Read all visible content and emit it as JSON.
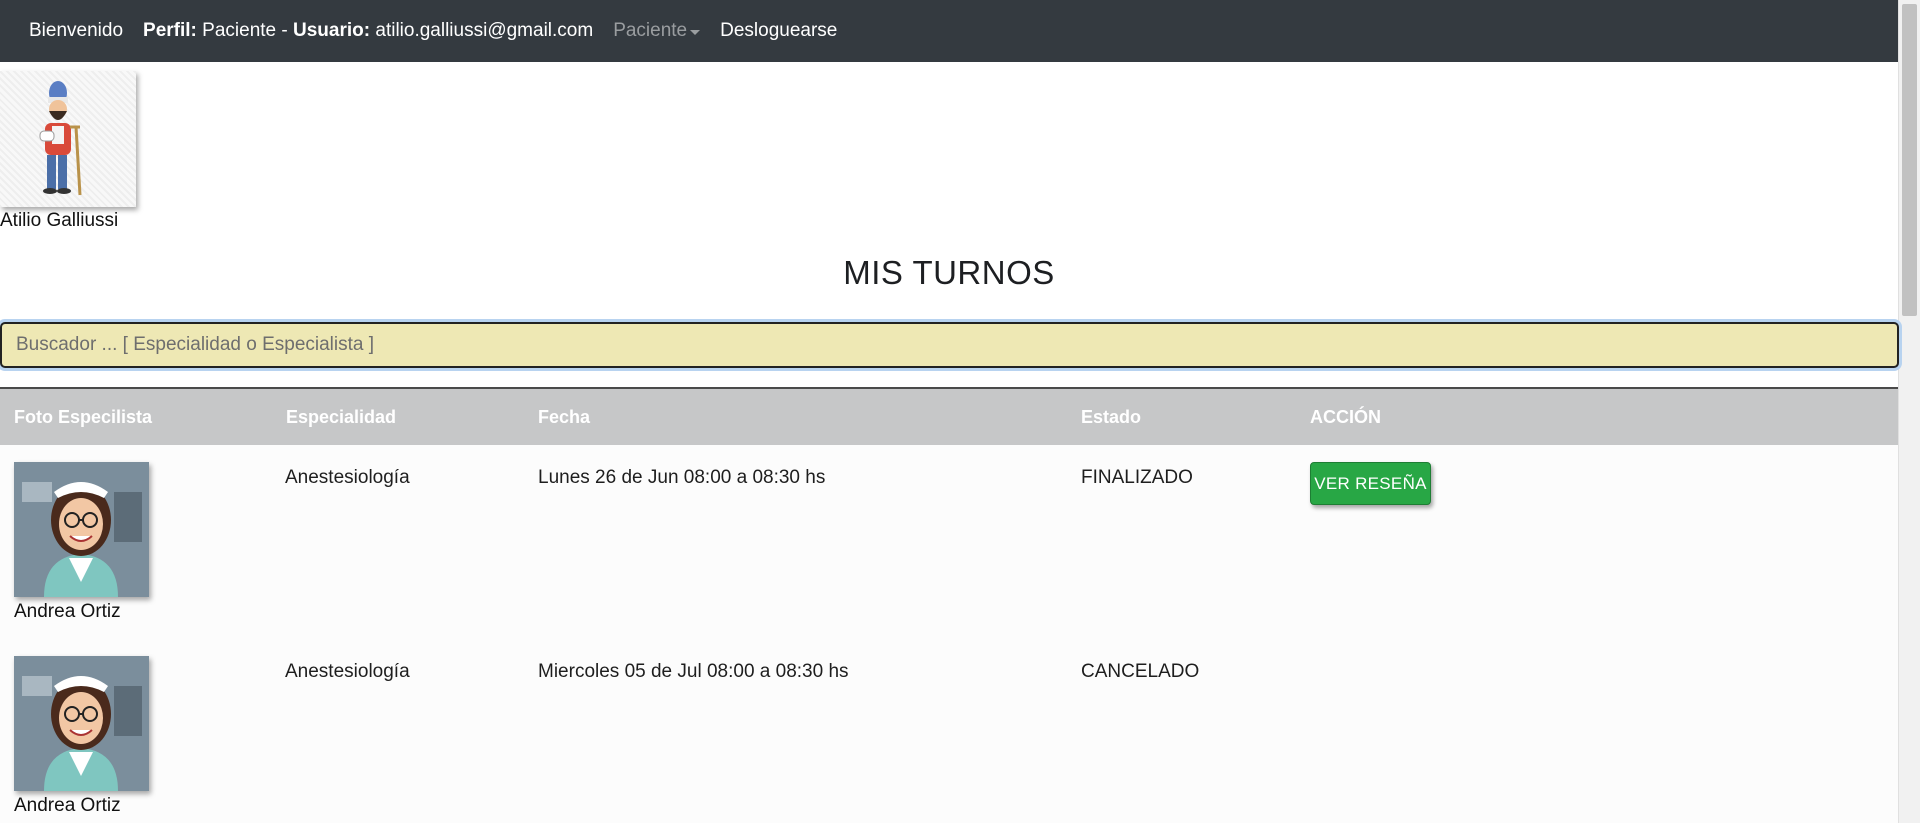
{
  "nav": {
    "welcome": "Bienvenido",
    "profile_label": "Perfil:",
    "profile_value": "Paciente",
    "separator": "-",
    "user_label": "Usuario:",
    "user_value": "atilio.galliussi@gmail.com",
    "dropdown_label": "Paciente",
    "logout": "Desloguearse"
  },
  "profile": {
    "name": "Atilio Galliussi",
    "avatar_icon": "patient-cartoon-avatar"
  },
  "page_title": "MIS TURNOS",
  "search": {
    "placeholder": "Buscador ... [ Especialidad o Especialista ]",
    "value": ""
  },
  "table": {
    "headers": [
      "Foto Especilista",
      "Especialidad",
      "Fecha",
      "Estado",
      "ACCIÓN"
    ],
    "rows": [
      {
        "doctor": "Andrea Ortiz",
        "specialty": "Anestesiología",
        "date": "Lunes 26 de Jun 08:00 a 08:30 hs",
        "status": "FINALIZADO",
        "action": "VER RESEÑA"
      },
      {
        "doctor": "Andrea Ortiz",
        "specialty": "Anestesiología",
        "date": "Miercoles 05 de Jul 08:00 a 08:30 hs",
        "status": "CANCELADO",
        "action": ""
      }
    ]
  },
  "colors": {
    "navbar": "#343a40",
    "search_bg": "#eee8b4",
    "table_header": "#c6c7c8",
    "button_success": "#28a745"
  }
}
